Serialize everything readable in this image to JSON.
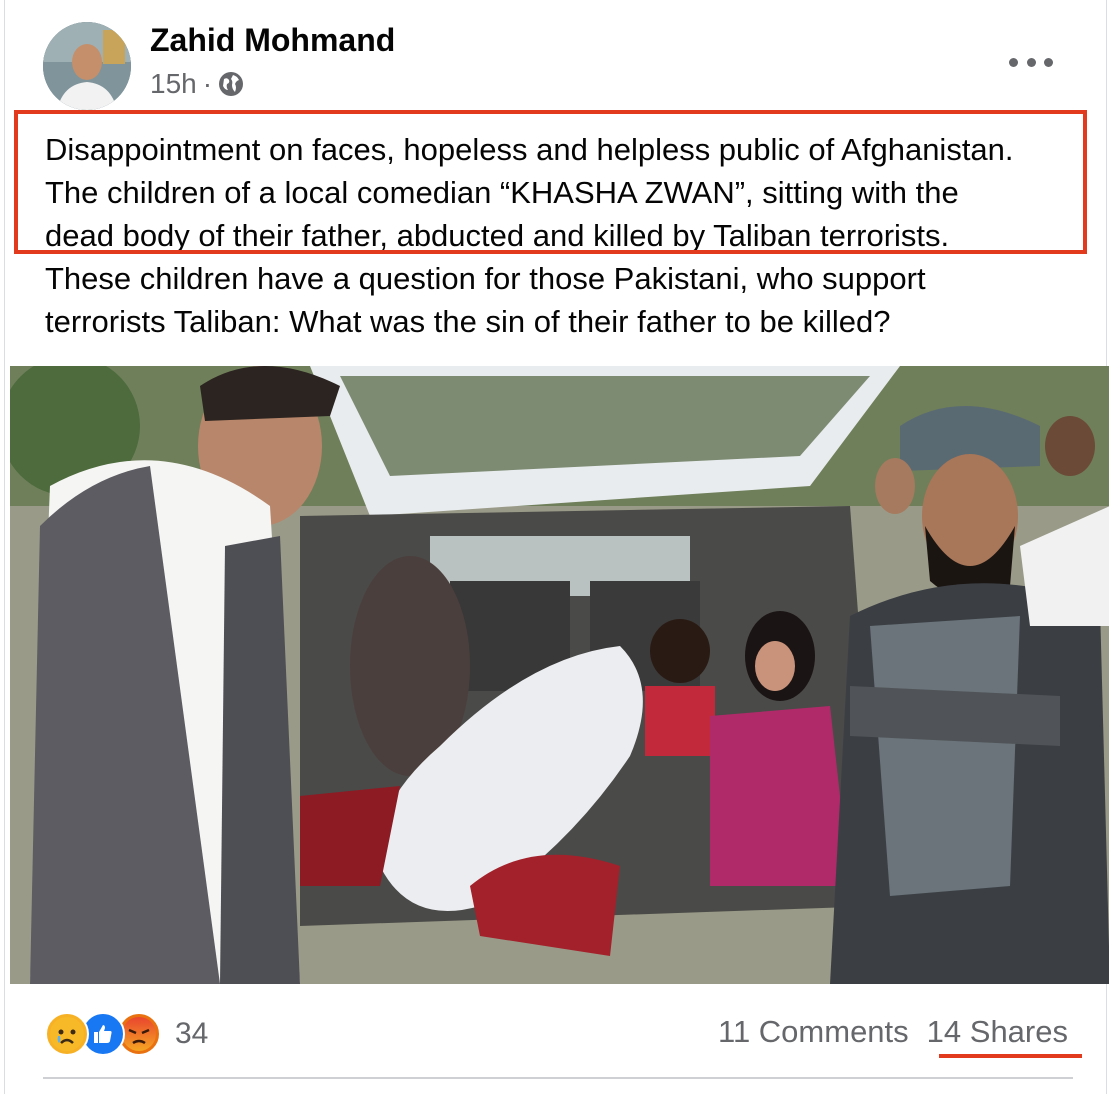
{
  "post": {
    "author": "Zahid Mohmand",
    "time": "15h",
    "separator": "·",
    "privacy_icon": "globe-icon",
    "text_lines": [
      "Disappointment on faces, hopeless and helpless public of Afghanistan.",
      "The children of a local comedian “KHASHA ZWAN”, sitting with the",
      "dead body of their father, abducted and killed by Taliban terrorists.",
      "These children have a question for those Pakistani, who support",
      "terrorists Taliban: What was the sin of their father to be killed?"
    ]
  },
  "footer": {
    "reaction_icons": [
      "sad-reaction-icon",
      "like-reaction-icon",
      "angry-reaction-icon"
    ],
    "reaction_count": "34",
    "comments": "11 Comments",
    "shares": "14 Shares"
  },
  "colors": {
    "annotation": "#e23a1c",
    "secondary_text": "#65676b",
    "like_blue": "#1877f2"
  }
}
